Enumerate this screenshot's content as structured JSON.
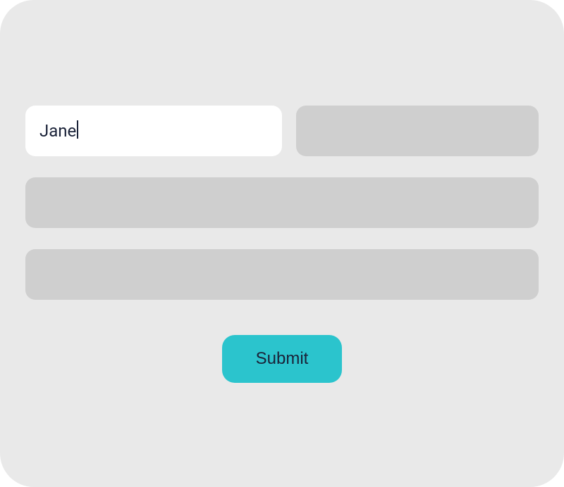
{
  "form": {
    "first_name_value": "Jane",
    "submit_label": "Submit"
  }
}
